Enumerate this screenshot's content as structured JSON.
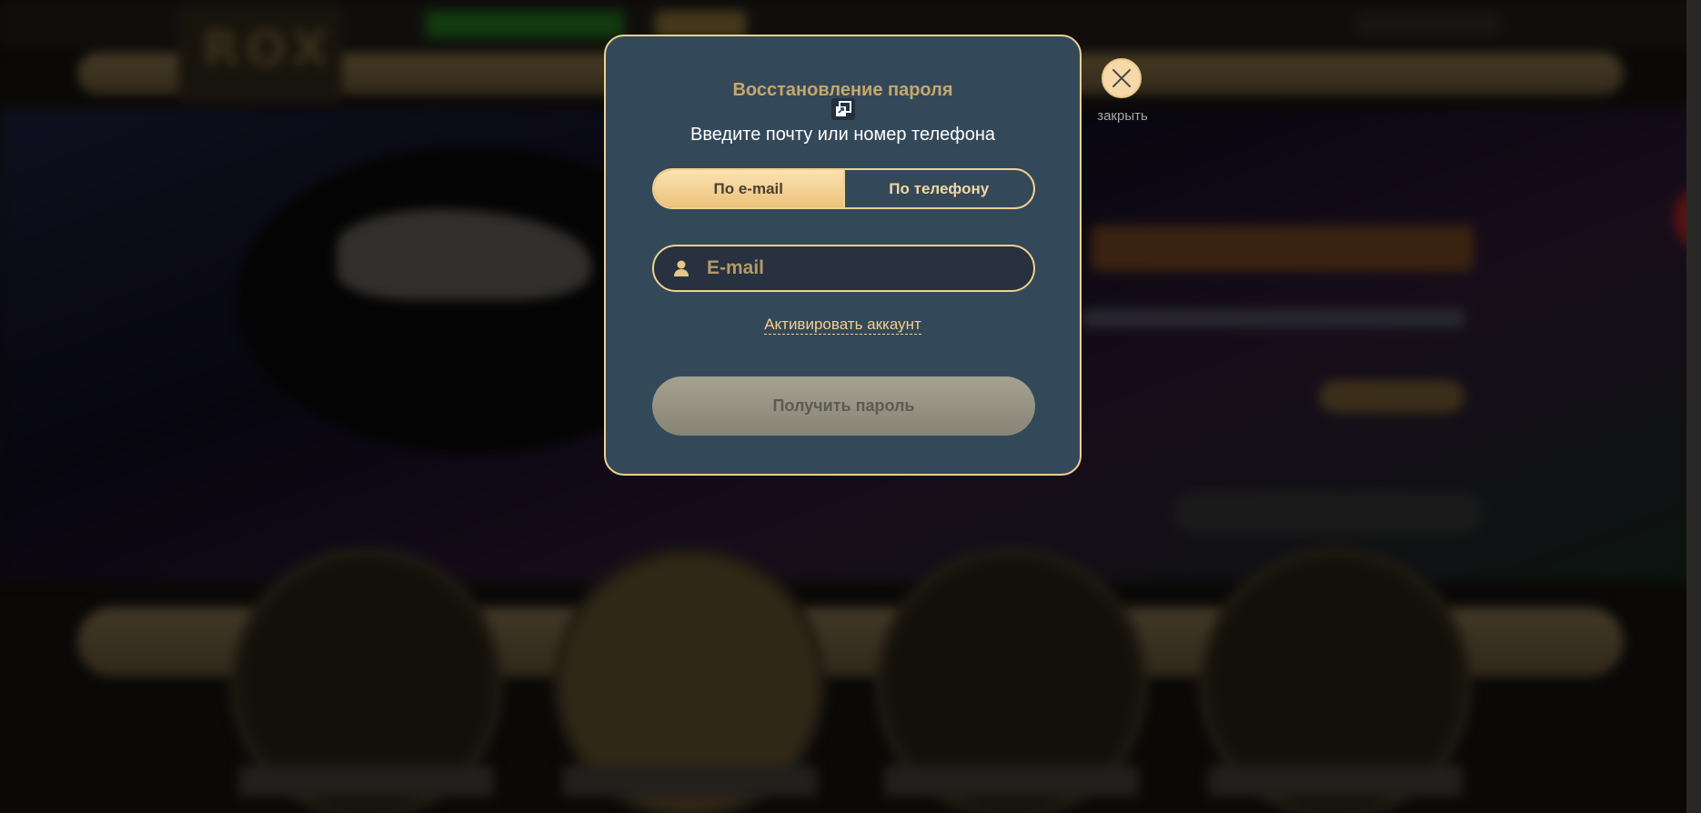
{
  "background": {
    "logo_text": "ROX"
  },
  "modal": {
    "title": "Восстановление пароля",
    "subtitle": "Введите почту или номер телефона",
    "tabs": [
      {
        "label": "По e-mail",
        "active": true
      },
      {
        "label": "По телефону",
        "active": false
      }
    ],
    "email_input": {
      "placeholder": "E-mail",
      "value": ""
    },
    "activate_link": "Активировать аккаунт",
    "submit_label": "Получить пароль",
    "submit_disabled": true
  },
  "close": {
    "label": "закрыть"
  },
  "colors": {
    "modal_bg": "#33495a",
    "accent_gold": "#f0d08e",
    "title_gold": "#c8a66a",
    "tab_active_bg": "#f5d59b",
    "submit_disabled_bg": "#98958a"
  },
  "icons": {
    "copy": "copy-window-icon",
    "user": "user-icon",
    "close": "close-icon"
  }
}
